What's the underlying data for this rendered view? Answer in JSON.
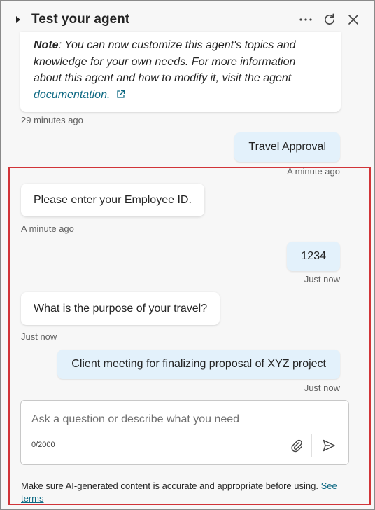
{
  "header": {
    "title": "Test your agent",
    "expand_icon": "caret-right-icon",
    "more_icon": "more-horizontal-icon",
    "refresh_icon": "refresh-icon",
    "close_icon": "close-icon"
  },
  "messages": {
    "note": {
      "label": "Note",
      "text_line1": ": You can now customize this agent's topics and",
      "text_line2": "knowledge for your own needs. For more information",
      "text_line3": "about this agent and how to modify it, visit the agent",
      "link_text": "documentation.",
      "link_icon": "open-external-icon",
      "timestamp": "29 minutes ago"
    },
    "user1": {
      "text": "Travel Approval",
      "timestamp": "A minute ago"
    },
    "bot1": {
      "text": "Please enter your Employee ID.",
      "timestamp": "A minute ago"
    },
    "user2": {
      "text": "1234",
      "timestamp": "Just now"
    },
    "bot2": {
      "text": "What is the purpose of your travel?",
      "timestamp": "Just now"
    },
    "user3": {
      "text": "Client meeting for finalizing proposal of XYZ project",
      "timestamp": "Just now"
    }
  },
  "input": {
    "placeholder": "Ask a question or describe what you need",
    "value": "",
    "counter": "0/2000",
    "attach_icon": "paperclip-icon",
    "send_icon": "send-icon"
  },
  "footer": {
    "disclaimer": "Make sure AI-generated content is accurate and appropriate before using.",
    "terms_link": "See terms"
  },
  "colors": {
    "highlight_border": "#d13438",
    "user_bubble": "#e3f1fb",
    "link": "#0f6a84"
  }
}
